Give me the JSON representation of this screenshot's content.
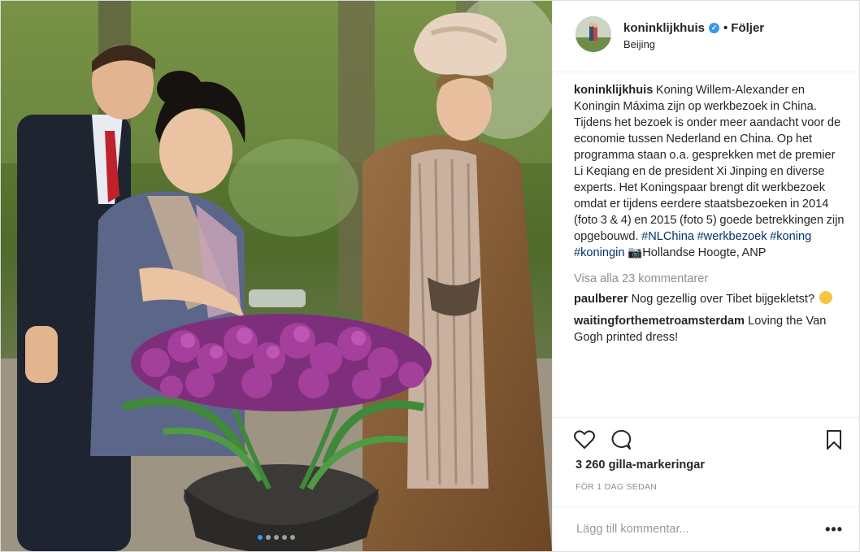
{
  "post": {
    "username": "koninklijkhuis",
    "follow_separator": "•",
    "follow_label": "Följer",
    "location": "Beijing",
    "caption_user": "koninklijkhuis",
    "caption_text": "Koning Willem-Alexander en Koningin Máxima zijn op werkbezoek in China. Tijdens het bezoek is onder meer aandacht voor de economie tussen Nederland en China. Op het programma staan o.a. gesprekken met de premier Li Keqiang en de president Xi Jinping en diverse experts. Het Koningspaar brengt dit werkbezoek omdat er tijdens eerdere staatsbezoeken in 2014 (foto 3 & 4) en 2015 (foto 5) goede betrekkingen zijn opgebouwd.",
    "hashtags": [
      "#NLChina",
      "#werkbezoek",
      "#koning",
      "#koningin"
    ],
    "caption_tail": "Hollandse Hoogte, ANP",
    "view_all": "Visa alla 23 kommentarer",
    "comments": [
      {
        "user": "paulberer",
        "text": "Nog gezellig over Tibet bijgekletst?"
      },
      {
        "user": "waitingforthemetroamsterdam",
        "text": "Loving the Van Gogh printed dress!"
      }
    ],
    "likes": "3 260 gilla-markeringar",
    "time": "FÖR 1 DAG SEDAN",
    "comment_placeholder": "Lägg till kommentar...",
    "more_label": "•••",
    "carousel": {
      "count": 5,
      "active_index": 0
    }
  },
  "colors": {
    "verified_blue": "#3897f0",
    "hashtag": "#003569",
    "muted": "#8e8e8e"
  },
  "icons": [
    "verified-badge-icon",
    "camera-icon",
    "heart-icon",
    "comment-bubble-icon",
    "bookmark-icon",
    "more-icon"
  ]
}
